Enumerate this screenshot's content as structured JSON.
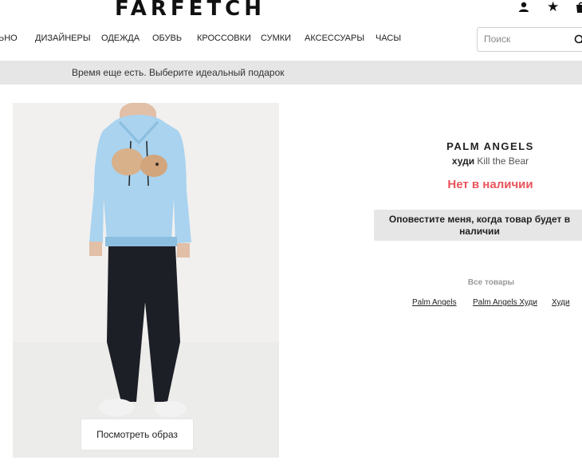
{
  "header": {
    "logo": "FARFETCH",
    "icons": [
      "account-icon",
      "wishlist-icon",
      "bag-icon"
    ],
    "wishlist_glyph": "★"
  },
  "nav": {
    "items": [
      "ЬНО",
      "ДИЗАЙНЕРЫ",
      "ОДЕЖДА",
      "ОБУВЬ",
      "КРОССОВКИ",
      "СУМКИ",
      "АКСЕССУАРЫ",
      "ЧАСЫ"
    ]
  },
  "search": {
    "placeholder": "Поиск"
  },
  "banner": {
    "text": "Время еще есть. Выберите идеальный подарок"
  },
  "gallery": {
    "look_button": "Посмотреть образ"
  },
  "product": {
    "brand": "PALM ANGELS",
    "category": "худи",
    "name": "Kill the Bear",
    "stock_status": "Нет в наличии",
    "notify_button": "Оповестите меня, когда товар будет в наличии"
  },
  "related": {
    "title": "Все товары",
    "links": [
      "Palm Angels",
      "Palm Angels Худи",
      "Худи"
    ]
  },
  "colors": {
    "accent_red": "#e9545a",
    "banner_gray": "#e6e6e6",
    "hoodie_blue": "#a9d3ef"
  }
}
